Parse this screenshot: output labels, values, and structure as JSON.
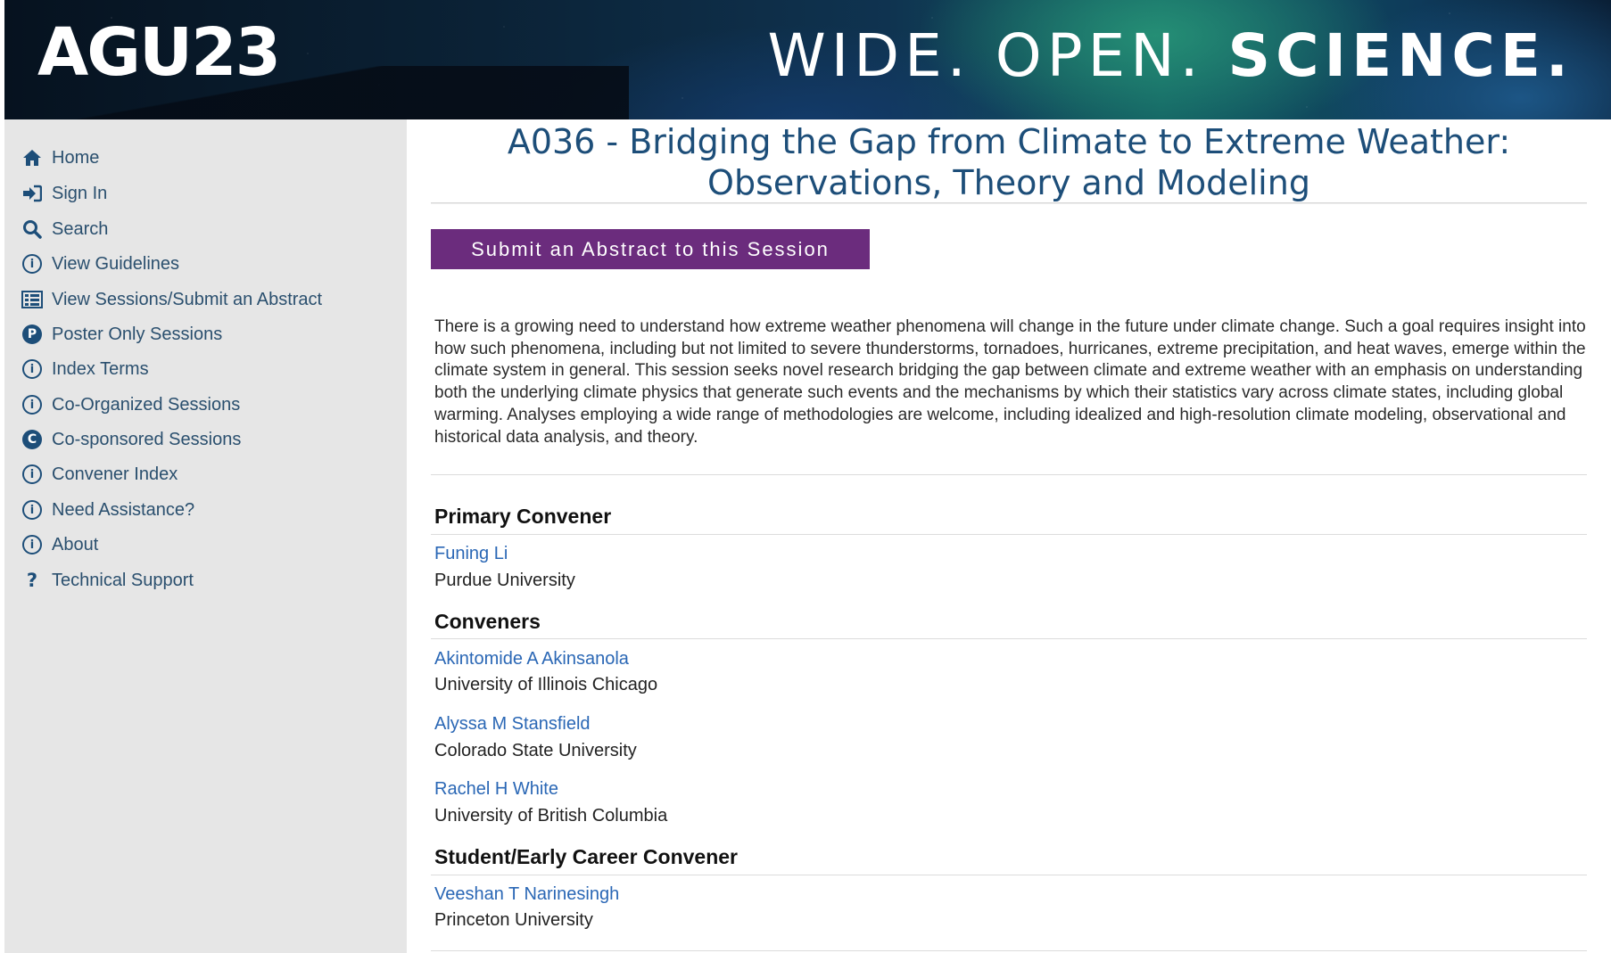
{
  "banner": {
    "logo": "AGU23",
    "tagline_part1": "WIDE. OPEN. ",
    "tagline_part2": "SCIENCE."
  },
  "sidebar": {
    "items": [
      {
        "label": "Home",
        "icon": "home-icon"
      },
      {
        "label": "Sign In",
        "icon": "sign-in-icon"
      },
      {
        "label": "Search",
        "icon": "search-icon"
      },
      {
        "label": "View Guidelines",
        "icon": "info-icon"
      },
      {
        "label": "View Sessions/Submit an Abstract",
        "icon": "list-icon"
      },
      {
        "label": "Poster Only Sessions",
        "icon": "p-circle-icon"
      },
      {
        "label": "Index Terms",
        "icon": "info-icon"
      },
      {
        "label": "Co-Organized Sessions",
        "icon": "info-icon"
      },
      {
        "label": "Co-sponsored Sessions",
        "icon": "c-circle-icon"
      },
      {
        "label": "Convener Index",
        "icon": "info-icon"
      },
      {
        "label": "Need Assistance?",
        "icon": "info-icon"
      },
      {
        "label": "About",
        "icon": "info-icon"
      },
      {
        "label": "Technical Support",
        "icon": "question-icon"
      }
    ]
  },
  "main": {
    "title_line1": "A036 - Bridging the Gap from Climate to Extreme Weather:",
    "title_line2": "Observations, Theory and Modeling",
    "submit_label": "Submit an Abstract to this Session",
    "description": "There is a growing need to understand how extreme weather phenomena will change in the future under climate change. Such a goal requires insight into how such phenomena, including but not limited to severe thunderstorms, tornadoes, hurricanes, extreme precipitation, and heat waves, emerge within the climate system in general. This session seeks novel research bridging the gap between climate and extreme weather with an emphasis on understanding both the underlying climate physics that generate such events and the mechanisms by which their statistics vary across climate states, including global warming. Analyses employing a wide range of methodologies are welcome, including idealized and high-resolution climate modeling, observational and historical data analysis, and theory.",
    "primary_heading": "Primary Convener",
    "primary": [
      {
        "name": "Funing Li",
        "affiliation": "Purdue University"
      }
    ],
    "conveners_heading": "Conveners",
    "conveners": [
      {
        "name": "Akintomide A Akinsanola",
        "affiliation": "University of Illinois Chicago"
      },
      {
        "name": "Alyssa M Stansfield",
        "affiliation": "Colorado State University"
      },
      {
        "name": "Rachel H White",
        "affiliation": "University of British Columbia"
      }
    ],
    "student_heading": "Student/Early Career Convener",
    "student": [
      {
        "name": "Veeshan T Narinesingh",
        "affiliation": "Princeton University"
      }
    ]
  },
  "colors": {
    "nav_text": "#2a4f6e",
    "title": "#1d4e79",
    "button": "#6b2c7d",
    "link": "#2a67b5",
    "sidebar_bg": "#e6e6e6"
  }
}
